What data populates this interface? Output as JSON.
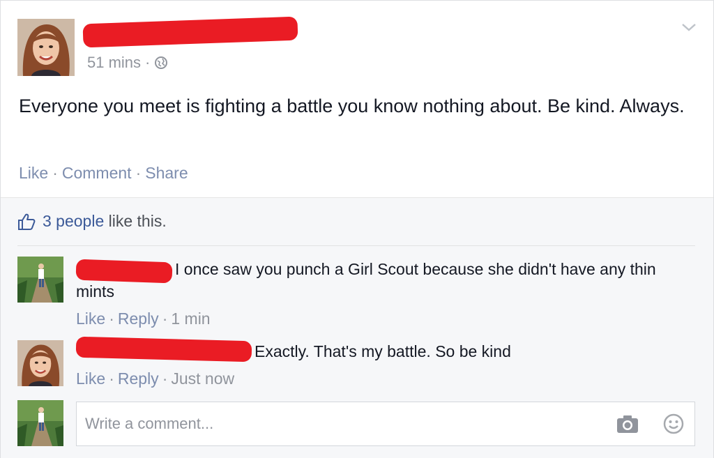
{
  "post": {
    "timestamp": "51 mins",
    "text": "Everyone you meet is fighting a battle you know nothing about. Be kind. Always.",
    "actions": {
      "like": "Like",
      "comment": "Comment",
      "share": "Share"
    },
    "privacy_icon": "globe-icon"
  },
  "likes": {
    "count_text": "3 people",
    "tail_text": "like this."
  },
  "comments": [
    {
      "text": "I once saw you punch a Girl Scout because she didn't have any thin mints",
      "like": "Like",
      "reply": "Reply",
      "time": "1 min"
    },
    {
      "text": "Exactly. That's my battle. So be kind",
      "like": "Like",
      "reply": "Reply",
      "time": "Just now"
    }
  ],
  "composer": {
    "placeholder": "Write a comment..."
  },
  "icons": [
    "chevron-down-icon",
    "thumbs-up-icon",
    "camera-icon",
    "emoji-icon"
  ],
  "colors": {
    "link": "#3b5998",
    "muted": "#90949c",
    "redaction": "#ea1c24",
    "panel": "#f6f7f9"
  }
}
